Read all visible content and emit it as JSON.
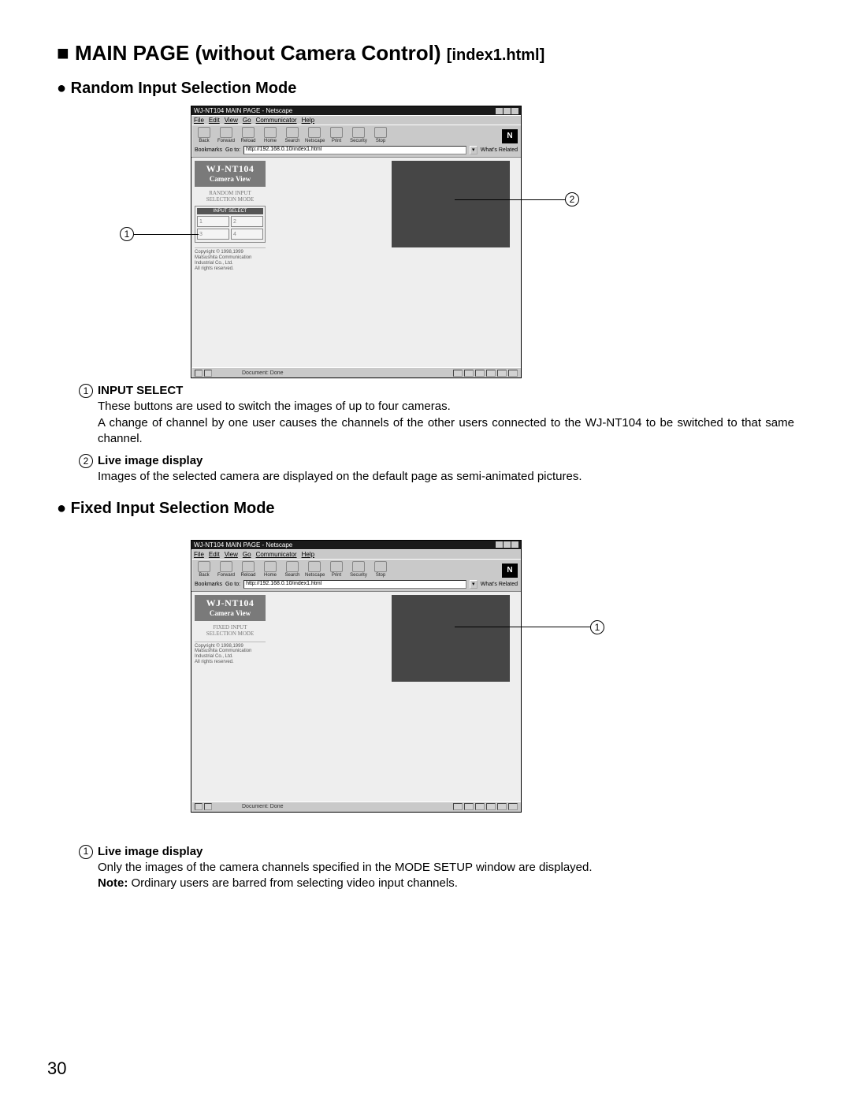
{
  "h1_main": "MAIN PAGE (without Camera Control)",
  "h1_file": "[index1.html]",
  "h2_random": "Random Input Selection Mode",
  "h2_fixed": "Fixed Input Selection Mode",
  "browser": {
    "title": "WJ-NT104 MAIN PAGE - Netscape",
    "menus": [
      "File",
      "Edit",
      "View",
      "Go",
      "Communicator",
      "Help"
    ],
    "tool_labels": [
      "Back",
      "Forward",
      "Reload",
      "Home",
      "Search",
      "Netscape",
      "Print",
      "Security",
      "Stop"
    ],
    "bookmarks_label": "Bookmarks",
    "goto_label": "Go to:",
    "location": "http://192.168.0.10/index1.html",
    "whats_related": "What's Related",
    "status_text": "Document: Done",
    "n_logo": "N"
  },
  "sidebar": {
    "logo_line1": "WJ-NT104",
    "logo_line2": "Camera View",
    "mode_random_l1": "RANDOM INPUT",
    "mode_random_l2": "SELECTION MODE",
    "mode_fixed_l1": "FIXED INPUT",
    "mode_fixed_l2": "SELECTION MODE",
    "input_select_title": "INPUT SELECT",
    "cells": [
      "1",
      "2",
      "3",
      "4"
    ],
    "copy_l1": "Copyright © 1998,1999",
    "copy_l2": "Matsushita Communication",
    "copy_l3": "Industrial Co., Ltd.",
    "copy_l4": "All rights reserved."
  },
  "desc_random": {
    "item1_title": "INPUT SELECT",
    "item1_p1": "These buttons are used to switch the images of up to four cameras.",
    "item1_p2": "A change of channel by one user causes the channels of the other users connected to the WJ-NT104 to be switched to that same channel.",
    "item2_title": "Live image display",
    "item2_p1": "Images of the selected camera are displayed on the default page as semi-animated pictures."
  },
  "desc_fixed": {
    "item1_title": "Live image display",
    "item1_p1": "Only the images of the camera channels specified in the MODE SETUP window are displayed.",
    "item1_note_label": "Note:",
    "item1_note_text": " Ordinary users are barred from selecting video input channels."
  },
  "callouts": {
    "one": "1",
    "two": "2"
  },
  "page_number": "30"
}
